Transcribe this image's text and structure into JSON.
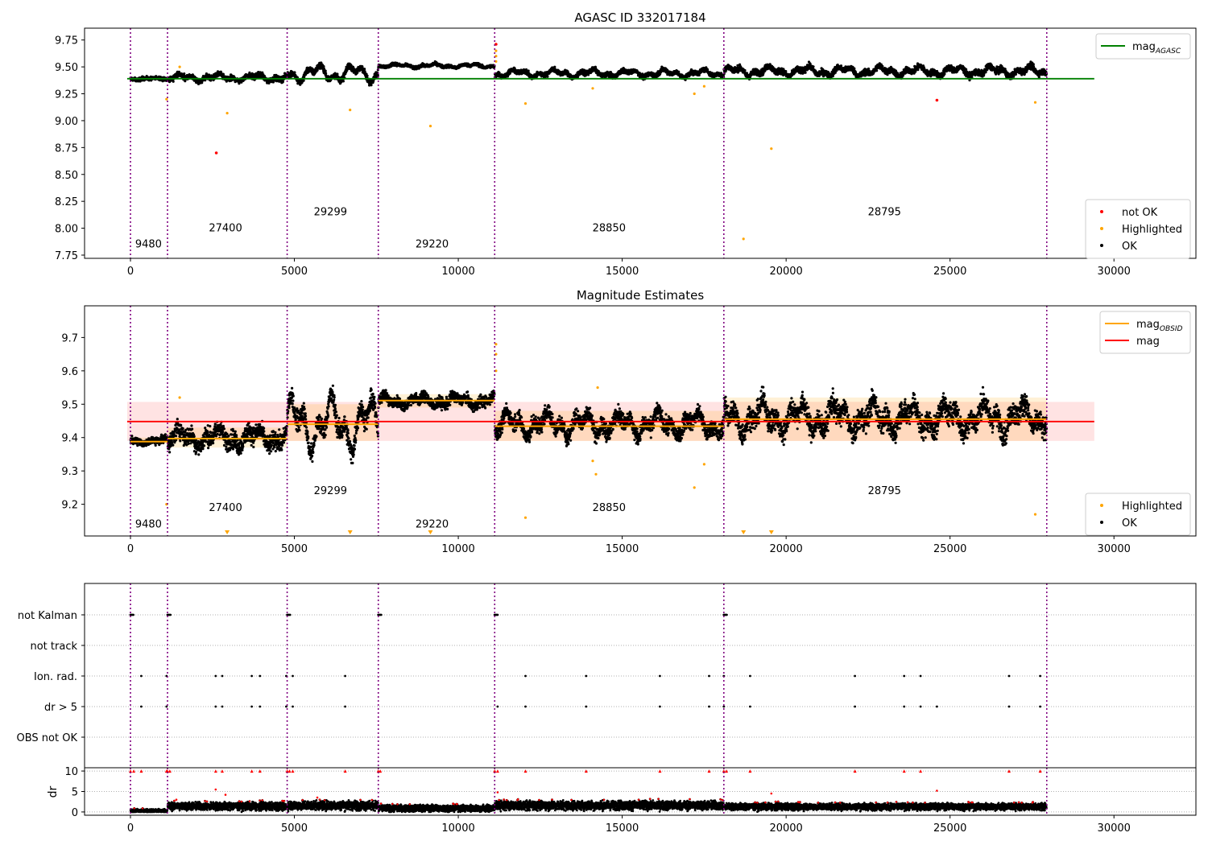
{
  "chart_data": [
    {
      "id": "agasc",
      "type": "scatter",
      "title": "AGASC ID 332017184",
      "xlim": [
        -1400,
        32500
      ],
      "ylim": [
        7.72,
        9.86
      ],
      "xticks": [
        0,
        5000,
        10000,
        15000,
        20000,
        25000,
        30000
      ],
      "yticks": [
        7.75,
        8.0,
        8.25,
        8.5,
        8.75,
        9.0,
        9.25,
        9.5,
        9.75
      ],
      "ytick_labels": [
        "7.75",
        "8.00",
        "8.25",
        "8.50",
        "8.75",
        "9.00",
        "9.25",
        "9.50",
        "9.75"
      ],
      "obsid_boundaries": [
        0,
        1130,
        4780,
        7560,
        11110,
        18100,
        27950
      ],
      "obsid_labels": [
        {
          "text": "9480",
          "x": 550,
          "y": 7.82
        },
        {
          "text": "27400",
          "x": 2900,
          "y": 7.97
        },
        {
          "text": "29299",
          "x": 6100,
          "y": 8.12
        },
        {
          "text": "29220",
          "x": 9200,
          "y": 7.82
        },
        {
          "text": "28850",
          "x": 14600,
          "y": 7.97
        },
        {
          "text": "28795",
          "x": 23000,
          "y": 8.12
        }
      ],
      "lines": [
        {
          "name": "mag_AGASC",
          "y": 9.39,
          "x_range": [
            -100,
            29400
          ],
          "color": "#008000"
        }
      ],
      "segments": [
        {
          "x_range": [
            0,
            1130
          ],
          "level": 9.39,
          "amp": 0.01,
          "spread": 0.012
        },
        {
          "x_range": [
            1130,
            4780
          ],
          "level": 9.4,
          "amp": 0.035,
          "spread": 0.018
        },
        {
          "x_range": [
            4780,
            7560
          ],
          "level": 9.44,
          "amp": 0.09,
          "spread": 0.02
        },
        {
          "x_range": [
            7560,
            11110
          ],
          "level": 9.51,
          "amp": 0.02,
          "spread": 0.01
        },
        {
          "x_range": [
            11110,
            18100
          ],
          "level": 9.44,
          "amp": 0.04,
          "spread": 0.015
        },
        {
          "x_range": [
            18100,
            27950
          ],
          "level": 9.46,
          "amp": 0.05,
          "spread": 0.02
        }
      ],
      "highlighted_points": [
        [
          1100,
          9.2
        ],
        [
          2950,
          9.07
        ],
        [
          6700,
          9.1
        ],
        [
          9150,
          8.95
        ],
        [
          12050,
          9.16
        ],
        [
          14100,
          9.3
        ],
        [
          17200,
          9.25
        ],
        [
          18700,
          7.9
        ],
        [
          19550,
          8.74
        ],
        [
          27600,
          9.17
        ],
        [
          11150,
          9.55
        ],
        [
          11150,
          9.6
        ],
        [
          11150,
          9.65
        ],
        [
          17500,
          9.32
        ],
        [
          1500,
          9.5
        ]
      ],
      "notok_points": [
        [
          2620,
          8.7
        ],
        [
          11150,
          9.71
        ],
        [
          24600,
          9.19
        ]
      ],
      "legend": {
        "placement": "lower-right",
        "entries": [
          {
            "label": "not OK",
            "color": "#ff0000"
          },
          {
            "label": "Highlighted",
            "color": "#ffa500"
          },
          {
            "label": "OK",
            "color": "#000000"
          }
        ]
      },
      "legend_lines": {
        "placement": "upper-right",
        "entries": [
          {
            "label": "mag",
            "sub": "AGASC",
            "color": "#008000"
          }
        ]
      }
    },
    {
      "id": "estimates",
      "type": "scatter",
      "title": "Magnitude Estimates",
      "xlim": [
        -1400,
        32500
      ],
      "ylim": [
        9.105,
        9.795
      ],
      "xticks": [
        0,
        5000,
        10000,
        15000,
        20000,
        25000,
        30000
      ],
      "yticks": [
        9.2,
        9.3,
        9.4,
        9.5,
        9.6,
        9.7
      ],
      "ytick_labels": [
        "9.2",
        "9.3",
        "9.4",
        "9.5",
        "9.6",
        "9.7"
      ],
      "obsid_boundaries": [
        0,
        1130,
        4780,
        7560,
        11110,
        18100,
        27950
      ],
      "obsid_labels": [
        {
          "text": "9480",
          "x": 550,
          "y": 9.13
        },
        {
          "text": "27400",
          "x": 2900,
          "y": 9.18
        },
        {
          "text": "29299",
          "x": 6100,
          "y": 9.23
        },
        {
          "text": "29220",
          "x": 9200,
          "y": 9.13
        },
        {
          "text": "28850",
          "x": 14600,
          "y": 9.18
        },
        {
          "text": "28795",
          "x": 23000,
          "y": 9.23
        }
      ],
      "mag": {
        "value": 9.448,
        "band": [
          9.39,
          9.507
        ],
        "x_range": [
          -100,
          29400
        ],
        "color": "#ff0000"
      },
      "obsid_mags": [
        {
          "x_range": [
            0,
            1130
          ],
          "value": 9.388,
          "band": [
            9.38,
            9.4
          ]
        },
        {
          "x_range": [
            1130,
            4780
          ],
          "value": 9.397,
          "band": [
            9.37,
            9.43
          ]
        },
        {
          "x_range": [
            4780,
            7560
          ],
          "value": 9.44,
          "band": [
            9.39,
            9.5
          ]
        },
        {
          "x_range": [
            7560,
            11110
          ],
          "value": 9.511,
          "band": [
            9.49,
            9.53
          ]
        },
        {
          "x_range": [
            11110,
            18100
          ],
          "value": 9.434,
          "band": [
            9.39,
            9.48
          ]
        },
        {
          "x_range": [
            18100,
            27950
          ],
          "value": 9.455,
          "band": [
            9.39,
            9.52
          ]
        }
      ],
      "segments": [
        {
          "x_range": [
            0,
            1130
          ],
          "level": 9.39,
          "amp": 0.008,
          "spread": 0.008
        },
        {
          "x_range": [
            1130,
            4780
          ],
          "level": 9.4,
          "amp": 0.03,
          "spread": 0.02
        },
        {
          "x_range": [
            4780,
            7560
          ],
          "level": 9.44,
          "amp": 0.09,
          "spread": 0.022
        },
        {
          "x_range": [
            7560,
            11110
          ],
          "level": 9.51,
          "amp": 0.018,
          "spread": 0.012
        },
        {
          "x_range": [
            11110,
            18100
          ],
          "level": 9.44,
          "amp": 0.04,
          "spread": 0.018
        },
        {
          "x_range": [
            18100,
            27950
          ],
          "level": 9.46,
          "amp": 0.05,
          "spread": 0.025
        }
      ],
      "highlighted_points": [
        [
          1100,
          9.2
        ],
        [
          12050,
          9.16
        ],
        [
          14100,
          9.33
        ],
        [
          14200,
          9.29
        ],
        [
          17200,
          9.25
        ],
        [
          27600,
          9.17
        ],
        [
          11150,
          9.6
        ],
        [
          11150,
          9.65
        ],
        [
          11150,
          9.68
        ],
        [
          17500,
          9.32
        ],
        [
          1500,
          9.52
        ],
        [
          14250,
          9.55
        ]
      ],
      "offscale_points": [
        2950,
        6700,
        9150,
        18700,
        19550
      ],
      "legend": {
        "placement": "lower-right",
        "entries": [
          {
            "label": "Highlighted",
            "color": "#ffa500"
          },
          {
            "label": "OK",
            "color": "#000000"
          }
        ]
      },
      "legend_lines": {
        "placement": "upper-right",
        "entries": [
          {
            "label": "mag",
            "sub": "OBSID",
            "color": "#ffa500"
          },
          {
            "label": "mag",
            "sub": "",
            "color": "#ff0000"
          }
        ]
      }
    },
    {
      "id": "flags",
      "type": "scatter",
      "xlim": [
        -1400,
        32500
      ],
      "categories": [
        "not Kalman",
        "not track",
        "Ion. rad.",
        "dr > 5",
        "OBS not OK"
      ],
      "obsid_boundaries": [
        0,
        1130,
        4780,
        7560,
        11110,
        18100,
        27950
      ],
      "flags": {
        "not Kalman": [
          0,
          1130,
          4780,
          7560,
          11110,
          18100
        ],
        "not track": [],
        "Ion. rad.": [
          330,
          1100,
          2600,
          2800,
          3700,
          3950,
          4750,
          4950,
          6550,
          12050,
          13900,
          16150,
          17650,
          18100,
          18900,
          22100,
          23600,
          24100,
          26800,
          27750
        ],
        "dr > 5": [
          330,
          1100,
          2600,
          2800,
          3700,
          3950,
          4750,
          4950,
          6550,
          11200,
          12050,
          13900,
          16150,
          17650,
          18100,
          18900,
          22100,
          23600,
          24100,
          24600,
          26800,
          27750
        ],
        "OBS not OK": []
      }
    },
    {
      "id": "dr",
      "type": "scatter",
      "ylabel": "dr",
      "xlim": [
        -1400,
        32500
      ],
      "ylim": [
        -0.8,
        10.8
      ],
      "xticks": [
        0,
        5000,
        10000,
        15000,
        20000,
        25000,
        30000
      ],
      "yticks": [
        0,
        5,
        10
      ],
      "ytick_labels": [
        "0",
        "5",
        "10"
      ],
      "obsid_boundaries": [
        0,
        1130,
        4780,
        7560,
        11110,
        18100,
        27950
      ],
      "segments": [
        {
          "x_range": [
            0,
            1130
          ],
          "level": 0.3,
          "spread": 0.3
        },
        {
          "x_range": [
            1130,
            4780
          ],
          "level": 1.4,
          "spread": 0.7
        },
        {
          "x_range": [
            4780,
            7560
          ],
          "level": 1.6,
          "spread": 0.8
        },
        {
          "x_range": [
            7560,
            11110
          ],
          "level": 0.9,
          "spread": 0.6
        },
        {
          "x_range": [
            11110,
            18100
          ],
          "level": 1.6,
          "spread": 0.8
        },
        {
          "x_range": [
            18100,
            27950
          ],
          "level": 1.3,
          "spread": 0.6
        }
      ],
      "clipped_points": [
        0,
        100,
        1130,
        1200,
        4780,
        4850,
        7560,
        7620,
        11110,
        11200,
        18100,
        18180,
        330,
        1100,
        2600,
        2800,
        3700,
        3950,
        4950,
        6550,
        12050,
        13900,
        16150,
        17650,
        18900,
        22100,
        23600,
        24100,
        26800,
        27750
      ],
      "red_points": [
        [
          2600,
          5.5
        ],
        [
          2900,
          4.2
        ],
        [
          19550,
          4.5
        ],
        [
          24600,
          5.2
        ],
        [
          11200,
          4.8
        ],
        [
          1400,
          3.0
        ],
        [
          5700,
          3.5
        ]
      ]
    }
  ]
}
